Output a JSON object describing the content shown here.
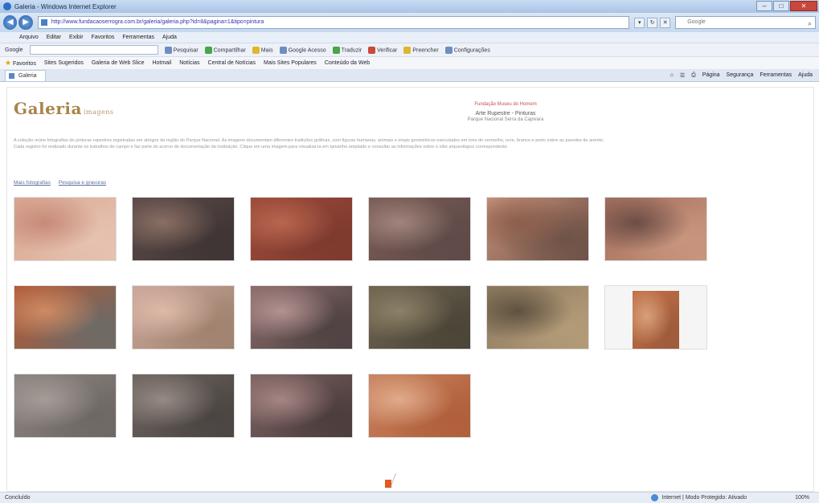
{
  "window": {
    "title": "Galeria - Windows Internet Explorer",
    "minimize": "–",
    "maximize": "□",
    "close": "✕"
  },
  "address": {
    "url": "http://www.fundacaoserrogra.com.br/galeria/galeria.php?id=8&pagina=1&tipo=pintura",
    "search_placeholder": "Google"
  },
  "menu": [
    "Arquivo",
    "Editar",
    "Exibir",
    "Favoritos",
    "Ferramentas",
    "Ajuda"
  ],
  "toolbar": {
    "search_label": "Google",
    "items": [
      "Pesquisar",
      "Compartilhar",
      "Mais",
      "Google Acesso",
      "Traduzir",
      "Verificar",
      "Preencher",
      "Configurações"
    ]
  },
  "favorites": {
    "label": "Favoritos",
    "items": [
      "Sites Sugeridos",
      "Galeria de Web Slice",
      "Hotmail",
      "Notícias",
      "Central de Notícias",
      "Mais Sites Populares",
      "Conteúdo da Web"
    ]
  },
  "tab": {
    "label": "Galeria"
  },
  "commands": [
    "Página",
    "Segurança",
    "Ferramentas",
    "Ajuda"
  ],
  "page": {
    "logo": "Galeria",
    "logo_sub": "imagens",
    "header_top": "Fundação Museu do Homem",
    "header_mid": "Arte Rupestre - Pinturas",
    "header_bot": "Parque Nacional Serra da Capivara",
    "description": [
      "A coleção reúne fotografias de pinturas rupestres registradas em abrigos da região do Parque Nacional. As imagens documentam diferentes tradições gráficas, com figuras humanas, animais e sinais geométricos executados em tons de vermelho, ocre, branco e preto sobre as paredes de arenito.",
      "Cada registro foi realizado durante os trabalhos de campo e faz parte do acervo de documentação da instituição. Clique em uma imagem para visualizá-la em tamanho ampliado e consultar as informações sobre o sítio arqueológico correspondente."
    ],
    "links": [
      "Mais fotografias",
      "Pesquisa e gravuras"
    ]
  },
  "thumbnails": [
    {
      "name": "thumb-1",
      "colors": [
        "#d9a792",
        "#c78a79",
        "#e6c2b0"
      ]
    },
    {
      "name": "thumb-2",
      "colors": [
        "#5b4a48",
        "#8a6f63",
        "#3f3535"
      ]
    },
    {
      "name": "thumb-3",
      "colors": [
        "#9b4a39",
        "#b8664f",
        "#7e3a2e"
      ]
    },
    {
      "name": "thumb-4",
      "colors": [
        "#7a5b55",
        "#a1847c",
        "#5e4a48"
      ]
    },
    {
      "name": "thumb-5",
      "colors": [
        "#c8917a",
        "#8b5e4d",
        "#6e5247"
      ]
    },
    {
      "name": "thumb-6",
      "colors": [
        "#a36e5d",
        "#6b4d45",
        "#c9957d"
      ]
    },
    {
      "name": "thumb-7",
      "colors": [
        "#b35a35",
        "#cf8a63",
        "#6d6a66"
      ]
    },
    {
      "name": "thumb-8",
      "colors": [
        "#c9a699",
        "#ddb9a8",
        "#a0826f"
      ]
    },
    {
      "name": "thumb-9",
      "colors": [
        "#8a6a6a",
        "#b39291",
        "#4f4242"
      ]
    },
    {
      "name": "thumb-10",
      "colors": [
        "#6f6450",
        "#8c8167",
        "#4b4538"
      ]
    },
    {
      "name": "thumb-11",
      "colors": [
        "#8d7a5f",
        "#5e513f",
        "#b39b78"
      ]
    },
    {
      "name": "thumb-12",
      "colors": [
        "#c27045",
        "#d9a079",
        "#9e5b3c"
      ]
    },
    {
      "name": "thumb-13",
      "colors": [
        "#8c8480",
        "#a59c97",
        "#6e6864"
      ]
    },
    {
      "name": "thumb-14",
      "colors": [
        "#6d6460",
        "#958a84",
        "#4b4542"
      ]
    },
    {
      "name": "thumb-15",
      "colors": [
        "#7d6262",
        "#a58684",
        "#4c3d3d"
      ]
    },
    {
      "name": "thumb-16",
      "colors": [
        "#c9825f",
        "#e0ab8b",
        "#b05f3a"
      ]
    }
  ],
  "status": {
    "left": "Concluído",
    "zone": "Internet | Modo Protegido: Ativado",
    "zoom": "100%"
  }
}
